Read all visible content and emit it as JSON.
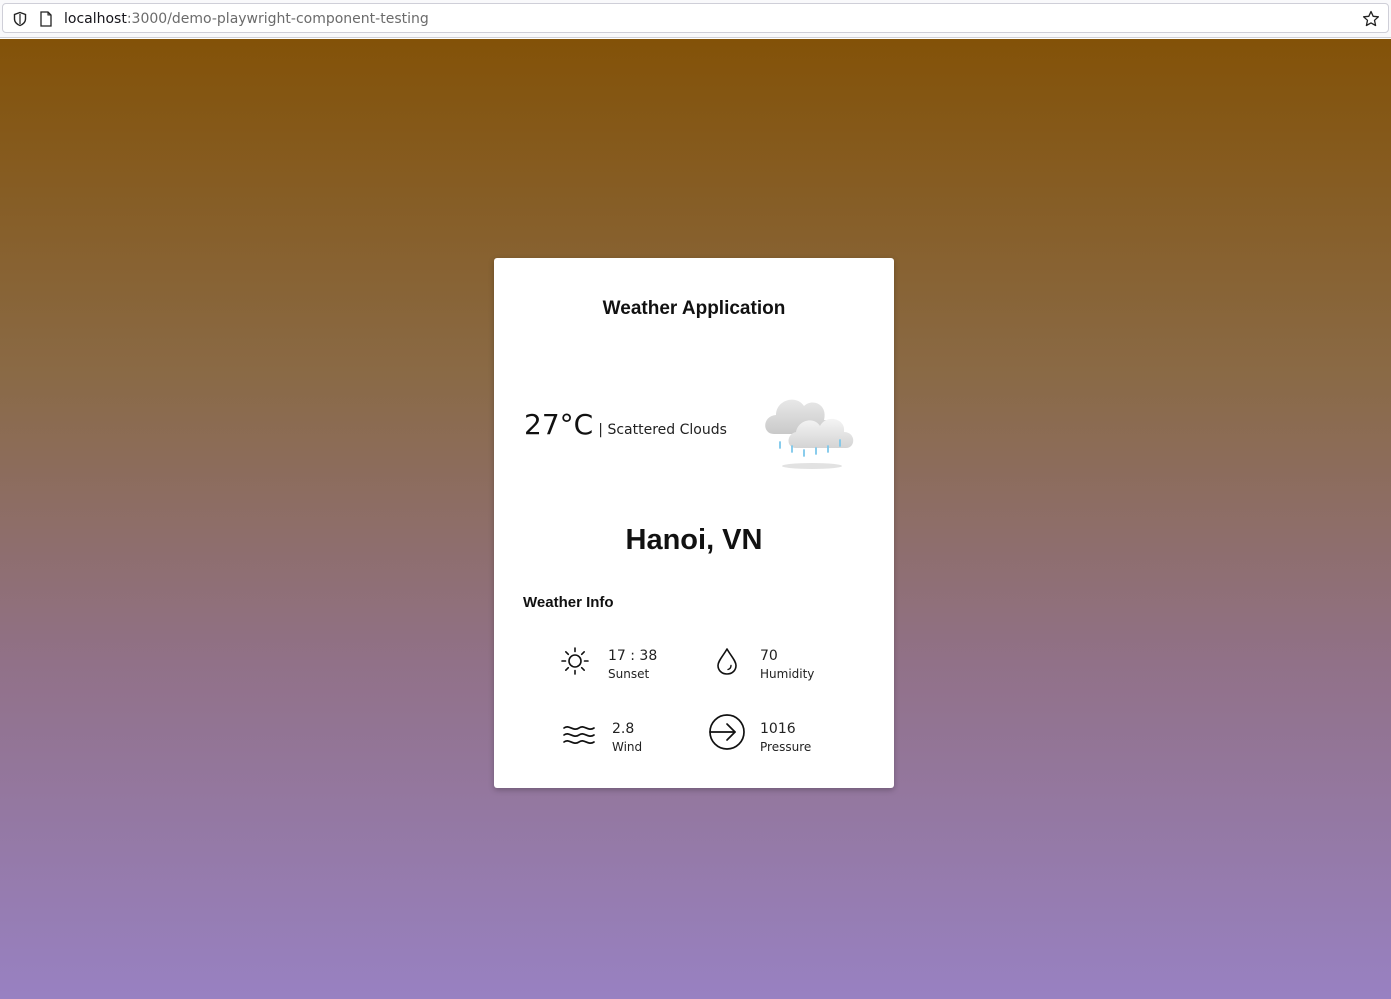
{
  "browser": {
    "url_host": "localhost",
    "url_path": ":3000/demo-playwright-component-testing"
  },
  "card": {
    "title": "Weather Application",
    "temperature": "27°C",
    "description": "| Scattered Clouds",
    "weather_icon": "rain-cloud-icon",
    "city": "Hanoi, VN",
    "info_heading": "Weather Info",
    "info": [
      {
        "value": "17 : 38",
        "label": "Sunset",
        "icon": "sun-icon"
      },
      {
        "value": "70",
        "label": "Humidity",
        "icon": "droplet-icon"
      },
      {
        "value": "2.8",
        "label": "Wind",
        "icon": "wind-icon"
      },
      {
        "value": "1016",
        "label": "Pressure",
        "icon": "arrow-circle-icon"
      }
    ]
  },
  "colors": {
    "gradient_top": "#835208",
    "gradient_bottom": "#9881c2",
    "card_bg": "#ffffff"
  }
}
